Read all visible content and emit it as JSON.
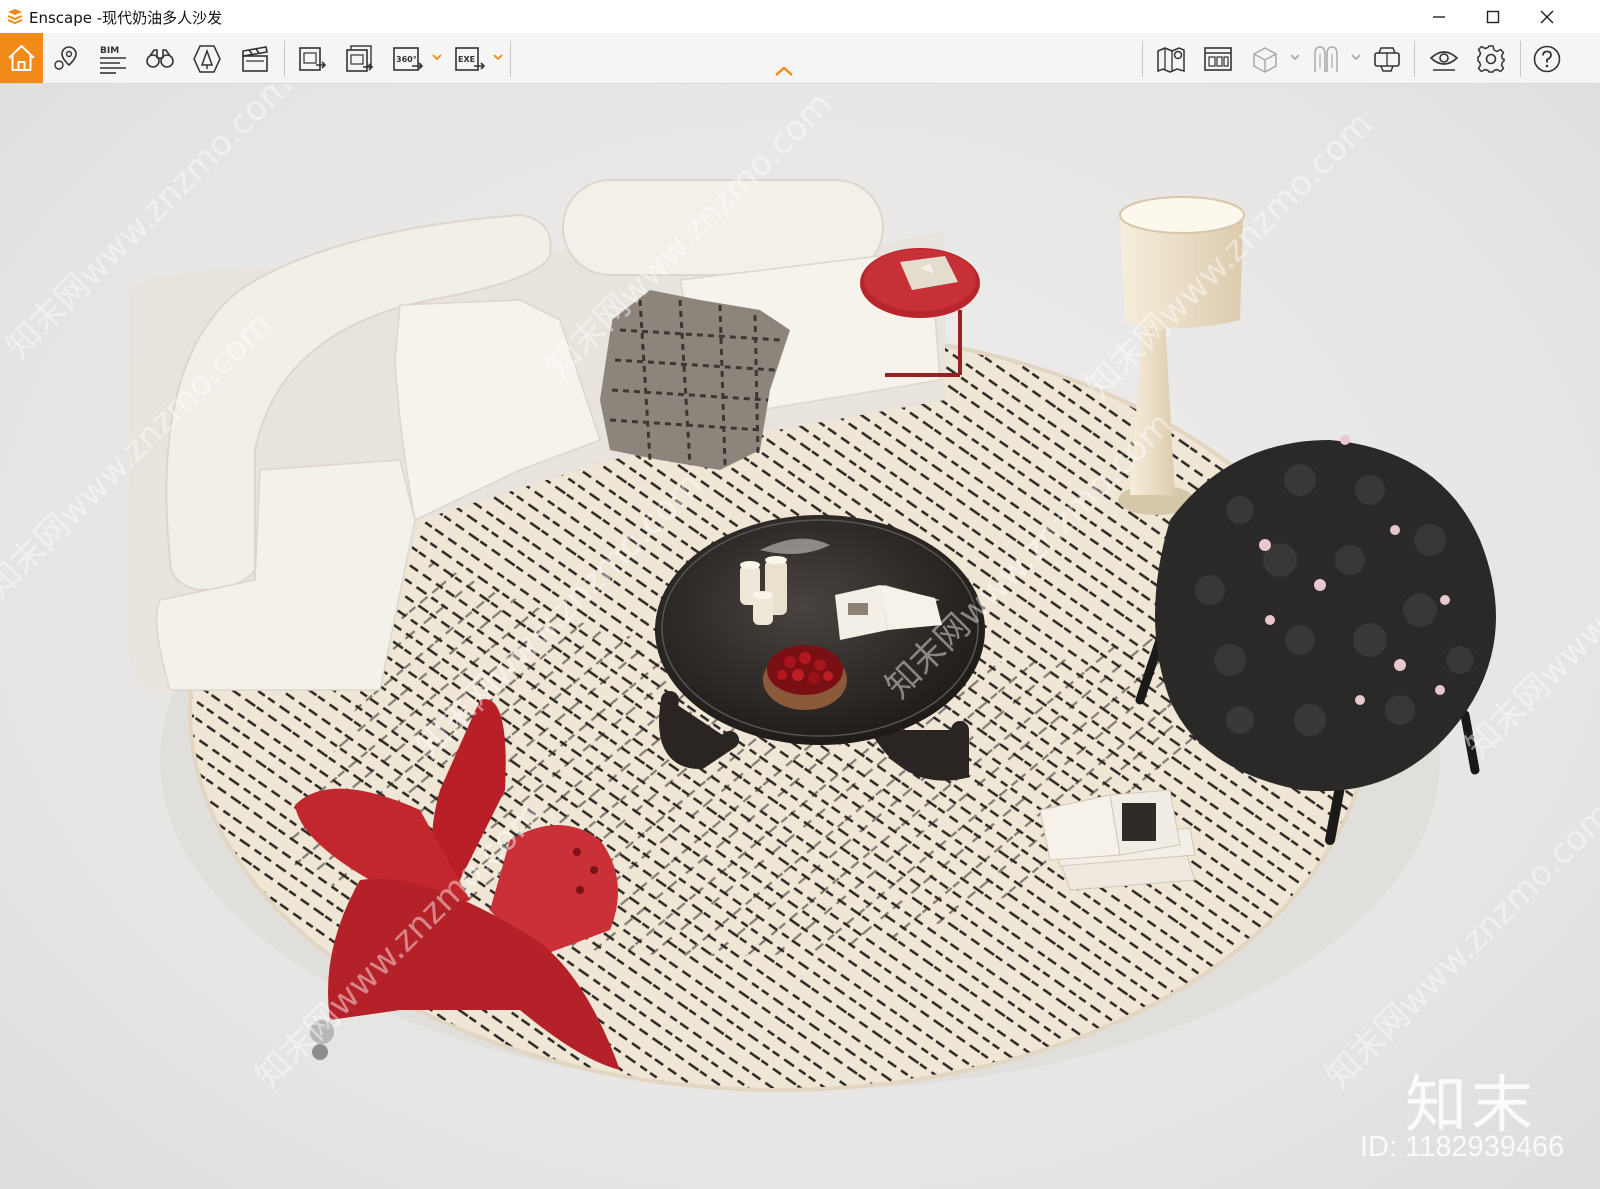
{
  "window": {
    "title": "Enscape -现代奶油多人沙发",
    "controls": [
      "minimize",
      "maximize",
      "close"
    ]
  },
  "toolbar": {
    "left_tools": [
      {
        "name": "home",
        "icon": "home-icon",
        "active": true
      },
      {
        "name": "views",
        "icon": "location-pin-icon"
      },
      {
        "name": "bim",
        "icon": "bim-icon",
        "label": "BIM"
      },
      {
        "name": "binoculars",
        "icon": "binoculars-icon"
      },
      {
        "name": "asset-library",
        "icon": "asset-library-icon"
      },
      {
        "name": "video-editor",
        "icon": "clapperboard-icon"
      },
      {
        "name": "screenshot-export",
        "icon": "image-export-icon"
      },
      {
        "name": "batch-export",
        "icon": "batch-export-icon"
      },
      {
        "name": "panorama-export",
        "icon": "panorama-export-icon",
        "label": "360°"
      },
      {
        "name": "exe-export",
        "icon": "exe-export-icon",
        "label": "EXE"
      }
    ],
    "right_tools": [
      {
        "name": "map",
        "icon": "map-icon"
      },
      {
        "name": "material-editor",
        "icon": "material-editor-icon"
      },
      {
        "name": "model-view",
        "icon": "cube-icon"
      },
      {
        "name": "collaborative",
        "icon": "collab-icon"
      },
      {
        "name": "vr-headset",
        "icon": "vr-headset-icon"
      },
      {
        "name": "visual-settings",
        "icon": "eye-icon"
      },
      {
        "name": "settings",
        "icon": "gear-icon"
      },
      {
        "name": "help",
        "icon": "help-icon"
      }
    ],
    "accent_color": "#f28a17"
  },
  "watermark": {
    "logo_text": "知末",
    "id_text": "ID: 1182939466",
    "repeat_text": "知末网www.znzmo.com"
  },
  "scene": {
    "objects": [
      "curved-cream-sofa",
      "knit-throw-blanket",
      "red-side-table",
      "floor-lamp",
      "round-patterned-rug",
      "black-coffee-table",
      "cherry-bowl",
      "candles",
      "open-book",
      "red-lily-armchair",
      "black-flower-armchair",
      "stacked-books"
    ]
  }
}
